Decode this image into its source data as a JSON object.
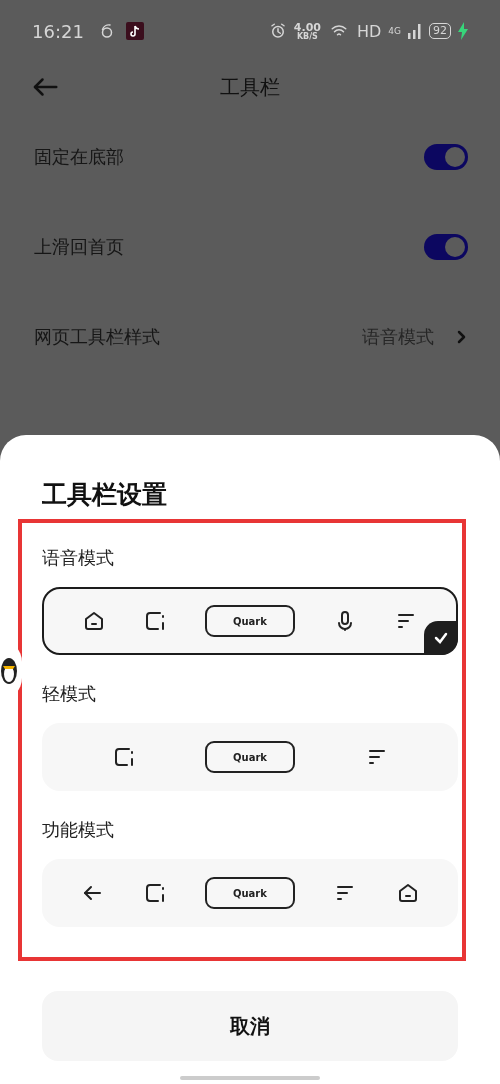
{
  "status_bar": {
    "time": "16:21",
    "speed_value": "4.00",
    "speed_unit": "KB/S",
    "hd": "HD",
    "network": "4G",
    "battery": "92",
    "charging": true
  },
  "header": {
    "title": "工具栏"
  },
  "settings": [
    {
      "kind": "toggle",
      "label": "固定在底部",
      "on": true
    },
    {
      "kind": "toggle",
      "label": "上滑回首页",
      "on": true
    },
    {
      "kind": "link",
      "label": "网页工具栏样式",
      "value": "语音模式"
    }
  ],
  "sheet": {
    "title": "工具栏设置",
    "options": [
      {
        "label": "语音模式",
        "selected": true,
        "items": [
          {
            "kind": "home"
          },
          {
            "kind": "tabs"
          },
          {
            "kind": "search",
            "text": "Quark"
          },
          {
            "kind": "mic"
          },
          {
            "kind": "menu"
          }
        ]
      },
      {
        "label": "轻模式",
        "selected": false,
        "items": [
          {
            "kind": "tabs"
          },
          {
            "kind": "search",
            "text": "Quark"
          },
          {
            "kind": "menu"
          }
        ]
      },
      {
        "label": "功能模式",
        "selected": false,
        "items": [
          {
            "kind": "back"
          },
          {
            "kind": "tabs"
          },
          {
            "kind": "search",
            "text": "Quark"
          },
          {
            "kind": "menu"
          },
          {
            "kind": "home"
          }
        ]
      }
    ],
    "cancel": "取消"
  }
}
